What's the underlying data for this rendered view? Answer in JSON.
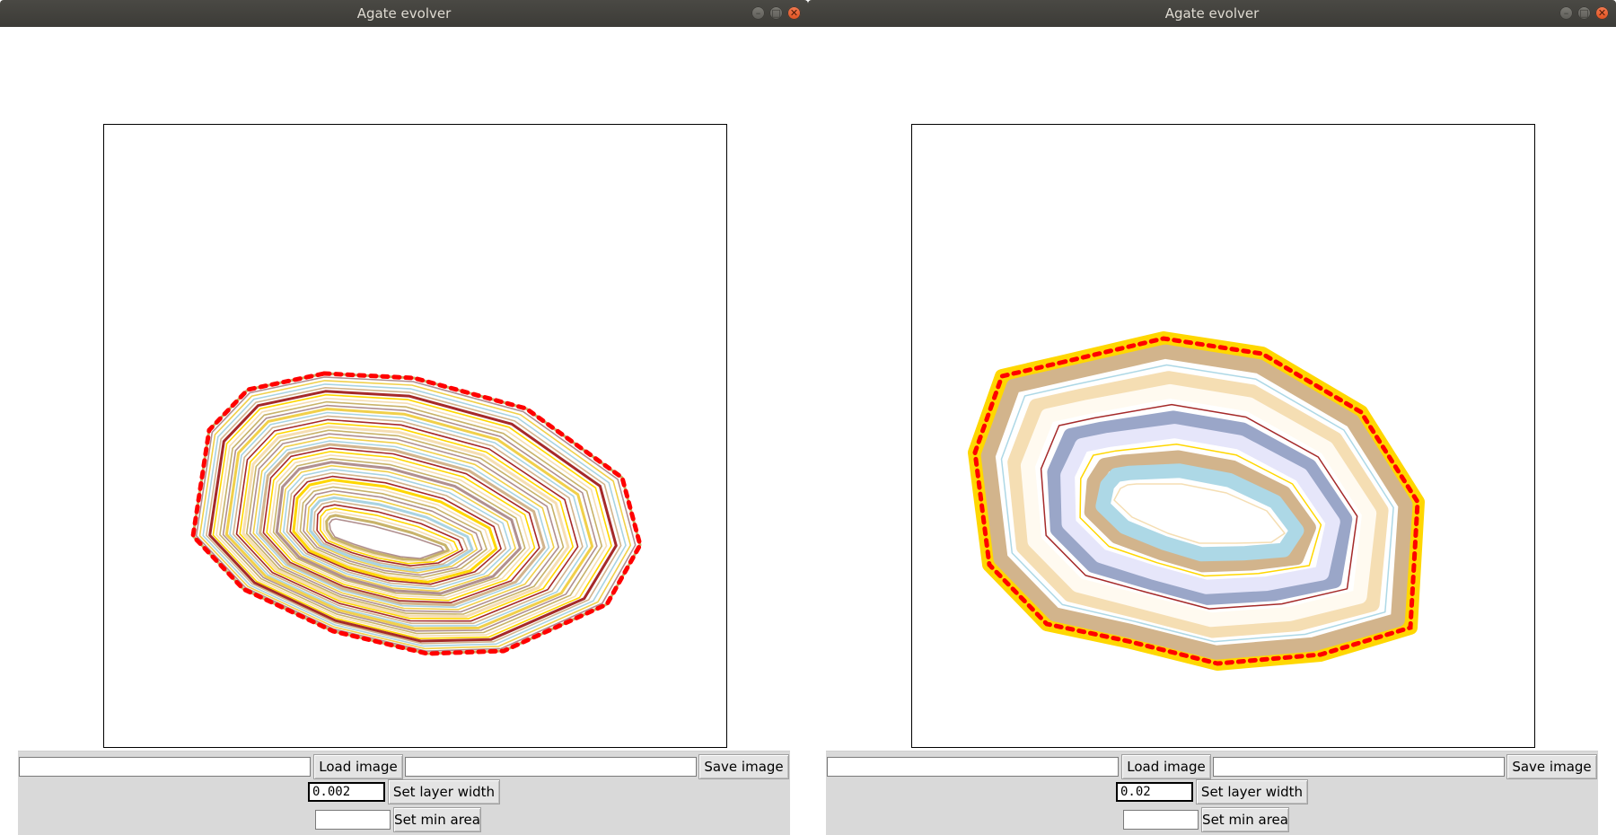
{
  "windows": [
    {
      "title": "Agate evolver",
      "controls": {
        "minimize": "–",
        "maximize": "□",
        "close": "✕"
      },
      "load_path_value": "",
      "load_button": "Load image",
      "save_path_value": "",
      "save_button": "Save image",
      "layer_width_value": "0.002",
      "set_layer_width_button": "Set layer width",
      "min_area_value": "",
      "set_min_area_button": "Set min area",
      "band_palette": [
        "#c8b36a",
        "#b08f8f",
        "#f1d04a",
        "#a9d3e2",
        "#d2b48c",
        "#a52a2a",
        "#ffd700",
        "#f5deb3"
      ],
      "boundary_color": "#ff0000"
    },
    {
      "title": "Agate evolver",
      "controls": {
        "minimize": "–",
        "maximize": "□",
        "close": "✕"
      },
      "load_path_value": "",
      "load_button": "Load image",
      "save_path_value": "",
      "save_button": "Save image",
      "layer_width_value": "0.02",
      "set_layer_width_button": "Set layer width",
      "min_area_value": "",
      "set_min_area_button": "Set min area",
      "band_palette": [
        "#ffd700",
        "#d2b48c",
        "#add8e6",
        "#f5deb3",
        "#fffaf0",
        "#a52a2a",
        "#9aa6c8",
        "#e6e6fa"
      ],
      "boundary_color": "#ff0000"
    }
  ]
}
